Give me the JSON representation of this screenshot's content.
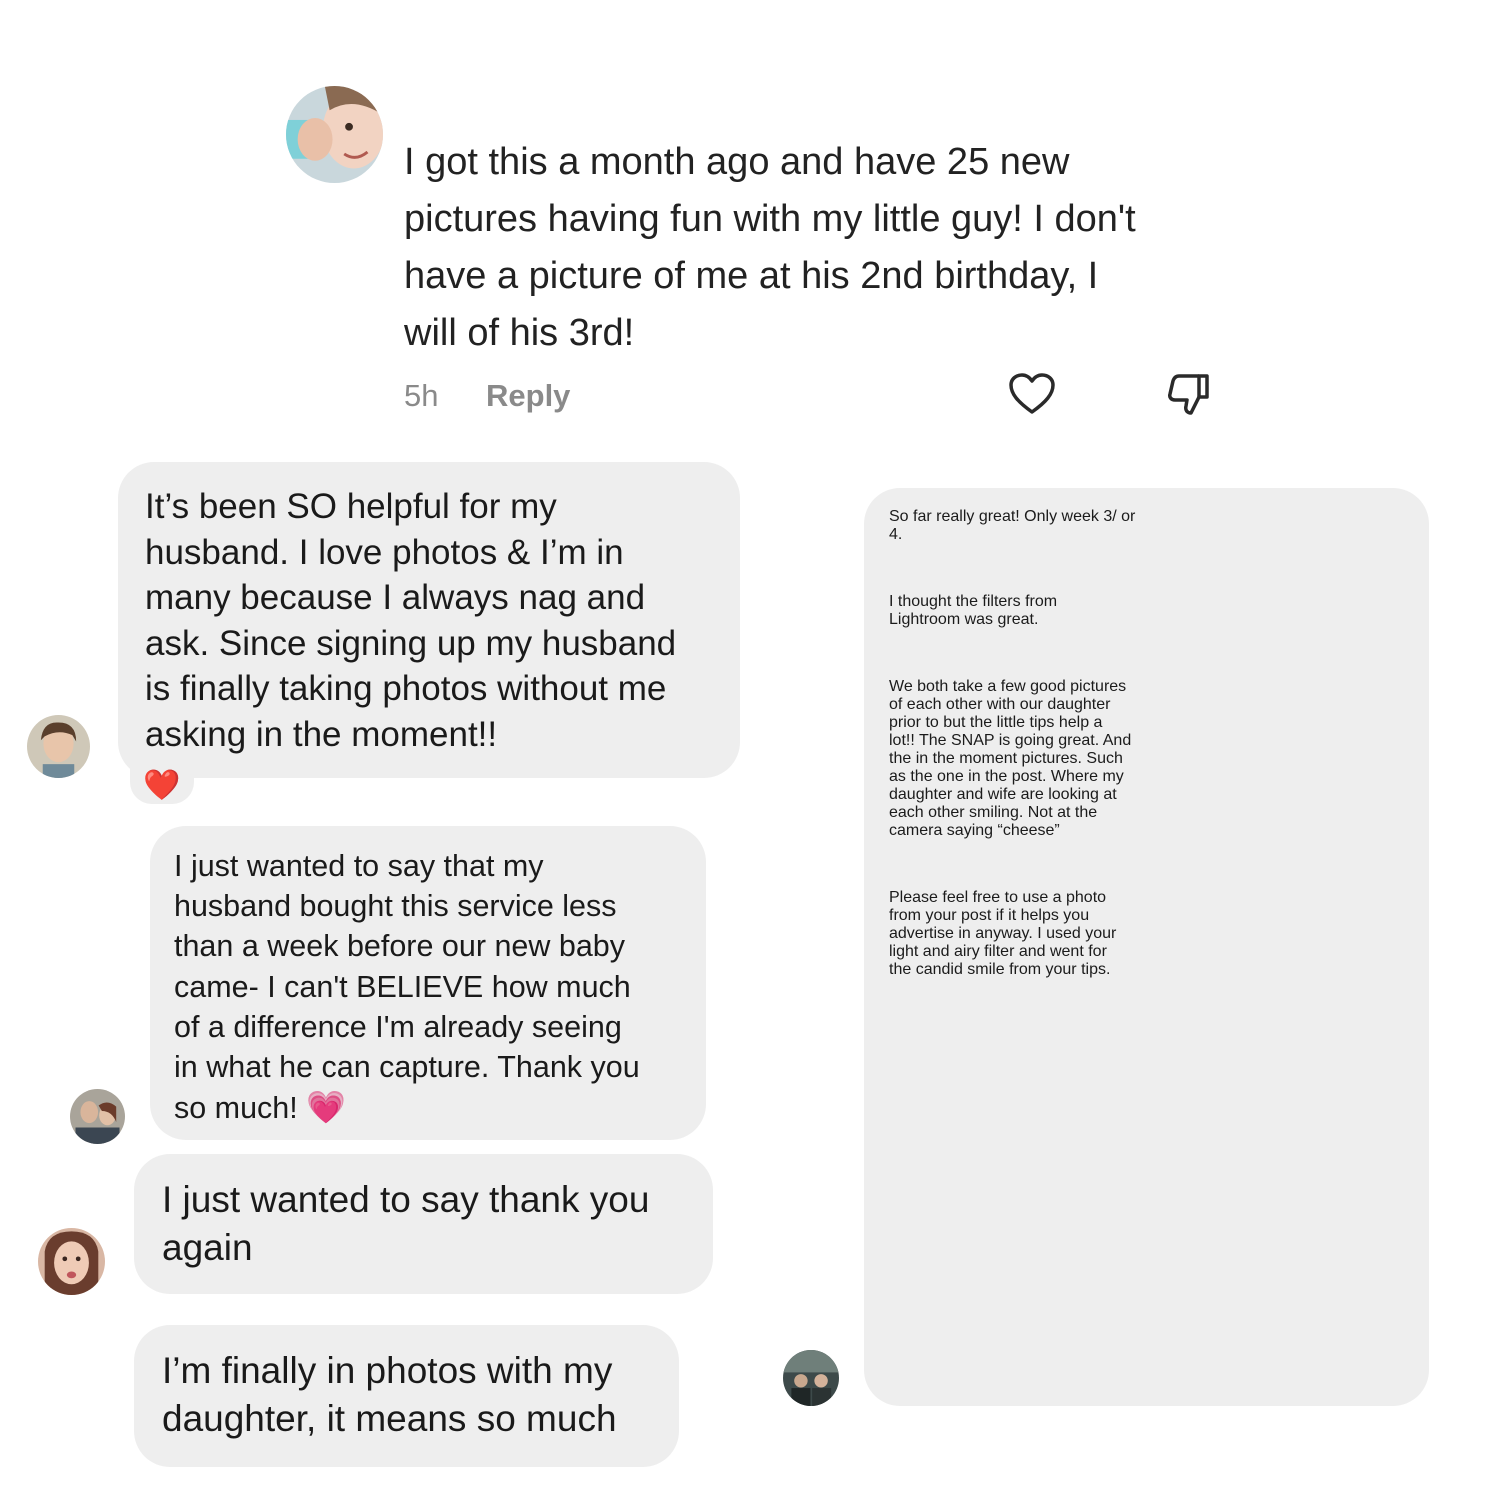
{
  "post_comment": {
    "text": "I got this a month ago and have 25 new\npictures having fun with my little guy! I don't\nhave a picture of me at his 2nd birthday, I\nwill of his 3rd!",
    "time": "5h",
    "reply_label": "Reply",
    "like_icon": "heart-outline-icon",
    "dislike_icon": "thumbs-down-icon"
  },
  "messages": [
    {
      "text": "It’s been SO helpful for my\nhusband. I love photos & I’m in\nmany because I always nag and\nask. Since signing up my husband\nis finally taking photos without me\nasking in the moment!!",
      "reaction": "❤️"
    },
    {
      "text": "I just wanted to say that my\nhusband bought this service less\nthan a week before our new baby\ncame- I can't BELIEVE how much\nof a difference I'm already seeing\nin what he can capture. Thank you\nso much!",
      "emoji": "💗"
    },
    {
      "text": "I just wanted to say thank you\nagain"
    },
    {
      "text": "I’m finally in photos with my\ndaughter, it means so much"
    },
    {
      "paragraphs": [
        "So far really great! Only week 3/ or\n4.",
        "I thought the filters from\nLightroom was great.",
        "We both take a few good pictures\nof each other with our daughter\nprior to but the little tips help a\nlot!! The SNAP is going great. And\nthe in the moment pictures. Such\nas the one in the post. Where my\ndaughter and wife are looking at\neach other smiling. Not at the\ncamera saying “cheese”",
        "Please feel free to use a photo\nfrom your post if it helps you\nadvertise in anyway. I used your\nlight and airy filter and went for\nthe candid smile from your tips."
      ]
    }
  ]
}
